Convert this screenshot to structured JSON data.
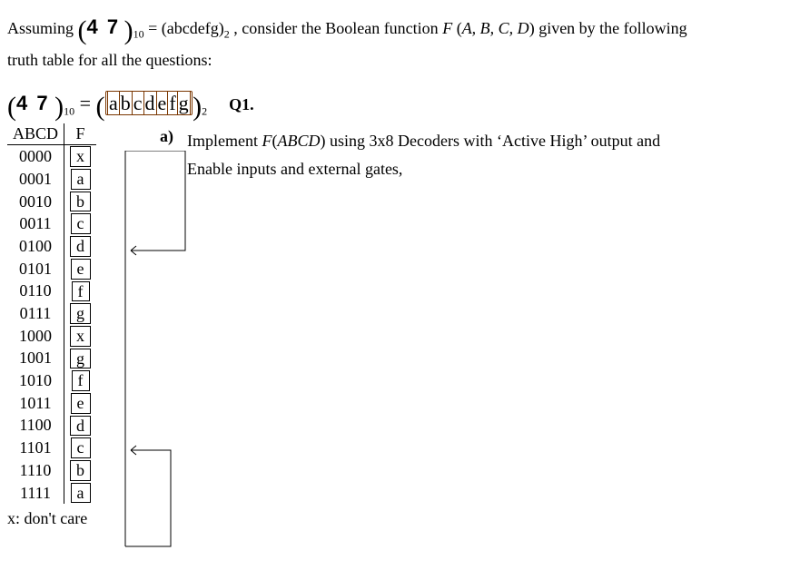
{
  "intro": {
    "prefix": "Assuming ",
    "lparen": "(",
    "hand": "4 7",
    "rparen": ")",
    "sub1": "10",
    "eq": " = ",
    "rhs_l": "(",
    "rhs": "abcdefg",
    "rhs_r": ")",
    "sub2": "2",
    "mid": ", consider the Boolean function ",
    "F": "F",
    "args_l": "(",
    "args": "A, B, C, D",
    "args_r": ")",
    "tail": " given by the following ",
    "line2": "truth table for all the questions:"
  },
  "expr": {
    "lparen": "(",
    "hand": "4 7",
    "rparen": ")",
    "sub1": "10",
    "eq": " = ",
    "group_l": "(",
    "letters": [
      "a",
      "b",
      "c",
      "d",
      "e",
      "f",
      "g"
    ],
    "group_r": ")",
    "sub2": "2"
  },
  "q1_label": "Q1.",
  "table": {
    "head_abcd": "ABCD",
    "head_f": "F",
    "rows": [
      {
        "abcd": "0000",
        "f": "x"
      },
      {
        "abcd": "0001",
        "f": "a"
      },
      {
        "abcd": "0010",
        "f": "b"
      },
      {
        "abcd": "0011",
        "f": "c"
      },
      {
        "abcd": "0100",
        "f": "d"
      },
      {
        "abcd": "0101",
        "f": "e"
      },
      {
        "abcd": "0110",
        "f": "f"
      },
      {
        "abcd": "0111",
        "f": "g"
      },
      {
        "abcd": "1000",
        "f": "x"
      },
      {
        "abcd": "1001",
        "f": "g"
      },
      {
        "abcd": "1010",
        "f": "f"
      },
      {
        "abcd": "1011",
        "f": "e"
      },
      {
        "abcd": "1100",
        "f": "d"
      },
      {
        "abcd": "1101",
        "f": "c"
      },
      {
        "abcd": "1110",
        "f": "b"
      },
      {
        "abcd": "1111",
        "f": "a"
      }
    ],
    "footnote": "x: don't care"
  },
  "qa": {
    "label": "a)",
    "part1": "Implement ",
    "F": "F",
    "args_l": "(",
    "args": "ABCD",
    "args_r": ")",
    "part2": " using 3x8 Decoders with ‘Active High’ output and Enable inputs and external gates,"
  }
}
